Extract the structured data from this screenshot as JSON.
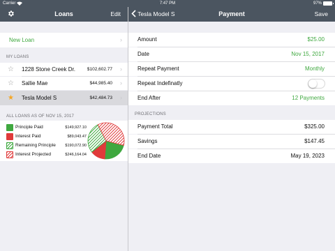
{
  "status_bar": {
    "carrier": "Carrier",
    "time": "7:47 PM",
    "battery": "97%",
    "battery_level": 0.97
  },
  "left_nav": {
    "title": "Loans",
    "settings_icon": "gear-icon",
    "edit_label": "Edit"
  },
  "right_nav": {
    "back_label": "Tesla Model S",
    "title": "Payment",
    "save_label": "Save"
  },
  "new_loan": {
    "label": "New Loan"
  },
  "my_loans": {
    "header": "MY LOANS",
    "items": [
      {
        "name": "1228 Stone Creek Dr.",
        "amount": "$102,602.77",
        "starred": false
      },
      {
        "name": "Sallie Mae",
        "amount": "$44,985.40",
        "starred": false
      },
      {
        "name": "Tesla Model S",
        "amount": "$42,484.73",
        "starred": true
      }
    ]
  },
  "summary": {
    "header": "ALL LOANS AS OF NOV 15, 2017",
    "legend": [
      {
        "label": "Principle Paid",
        "value": "$149,927.10"
      },
      {
        "label": "Interest Paid",
        "value": "$89,043.47"
      },
      {
        "label": "Remaining Principle",
        "value": "$190,072.90"
      },
      {
        "label": "Interest Projected",
        "value": "$246,164.04"
      }
    ],
    "colors": {
      "green": "#3fa83f",
      "red": "#e03a3a"
    }
  },
  "payment": {
    "amount_label": "Amount",
    "amount_value": "$25.00",
    "date_label": "Date",
    "date_value": "Nov 15, 2017",
    "repeat_label": "Repeat Payment",
    "repeat_value": "Monthly",
    "repeat_indef_label": "Repeat Indefinatly",
    "repeat_indef_on": false,
    "end_after_label": "End After",
    "end_after_value": "12 Payments"
  },
  "projections": {
    "header": "PROJECTIONS",
    "payment_total_label": "Payment Total",
    "payment_total_value": "$325.00",
    "savings_label": "Savings",
    "savings_value": "$147.45",
    "end_date_label": "End Date",
    "end_date_value": "May 19, 2023"
  },
  "accent_color": "#3fa83f"
}
